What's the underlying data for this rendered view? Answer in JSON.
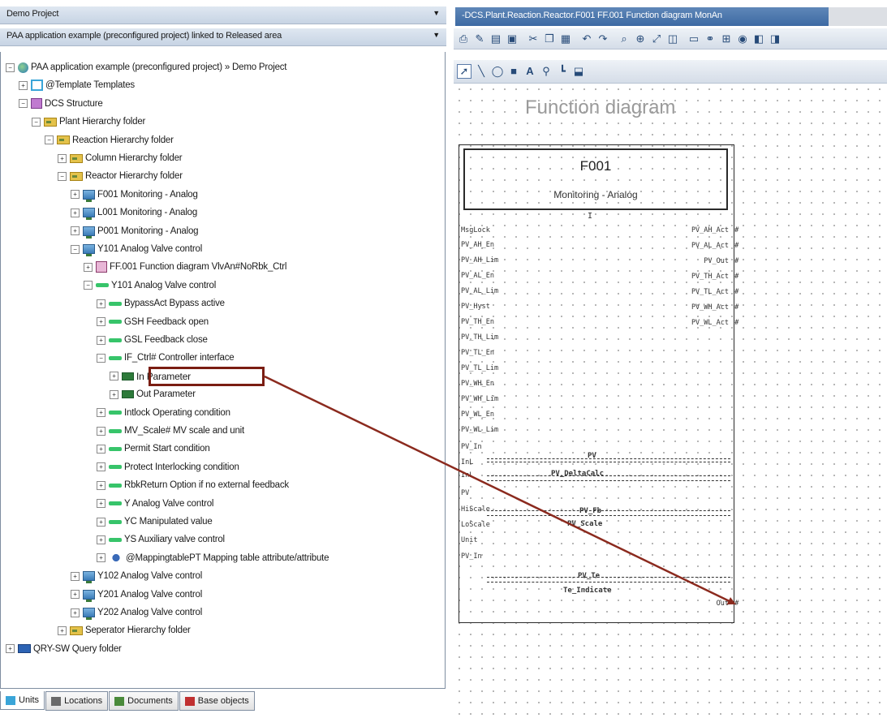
{
  "project_combo": "Demo Project",
  "app_combo": "PAA application example (preconfigured project)  linked to Released area",
  "tree": [
    {
      "label": "PAA application example (preconfigured project)   » Demo Project",
      "icon": "globe-icon",
      "indent": 0,
      "exp": "−"
    },
    {
      "label": "@Template  Templates",
      "icon": "template-icon",
      "indent": 1,
      "exp": "+"
    },
    {
      "label": "DCS  Structure",
      "icon": "structure-icon",
      "indent": 1,
      "exp": "−"
    },
    {
      "label": "Plant  Hierarchy folder",
      "icon": "folder-icon",
      "indent": 2,
      "exp": "−"
    },
    {
      "label": "Reaction  Hierarchy folder",
      "icon": "folder-icon",
      "indent": 3,
      "exp": "−"
    },
    {
      "label": "Column  Hierarchy folder",
      "icon": "folder-icon",
      "indent": 4,
      "exp": "+"
    },
    {
      "label": "Reactor  Hierarchy folder",
      "icon": "folder-icon",
      "indent": 4,
      "exp": "−"
    },
    {
      "label": "F001  Monitoring - Analog",
      "icon": "device-icon",
      "indent": 5,
      "exp": "+"
    },
    {
      "label": "L001  Monitoring - Analog",
      "icon": "device-icon",
      "indent": 5,
      "exp": "+"
    },
    {
      "label": "P001  Monitoring - Analog",
      "icon": "device-icon",
      "indent": 5,
      "exp": "+"
    },
    {
      "label": "Y101  Analog Valve control",
      "icon": "device-icon",
      "indent": 5,
      "exp": "−"
    },
    {
      "label": "FF.001  Function diagram VlvAn#NoRbk_Ctrl",
      "icon": "function-diagram-icon",
      "indent": 6,
      "exp": "+"
    },
    {
      "label": "Y101  Analog Valve control",
      "icon": "interface-icon",
      "indent": 6,
      "exp": "−"
    },
    {
      "label": "BypassAct  Bypass active",
      "icon": "interface-icon",
      "indent": 7,
      "exp": "+"
    },
    {
      "label": "GSH  Feedback open",
      "icon": "interface-icon",
      "indent": 7,
      "exp": "+"
    },
    {
      "label": "GSL  Feedback close",
      "icon": "interface-icon",
      "indent": 7,
      "exp": "+"
    },
    {
      "label": "IF_Ctrl#  Controller interface",
      "icon": "interface-icon",
      "indent": 7,
      "exp": "−"
    },
    {
      "label": "In  Parameter",
      "icon": "parameter-icon",
      "indent": 8,
      "exp": "+"
    },
    {
      "label": "Out  Parameter",
      "icon": "parameter-icon",
      "indent": 8,
      "exp": "+"
    },
    {
      "label": "Intlock  Operating condition",
      "icon": "interface-icon",
      "indent": 7,
      "exp": "+"
    },
    {
      "label": "MV_Scale#  MV scale and unit",
      "icon": "interface-icon",
      "indent": 7,
      "exp": "+"
    },
    {
      "label": "Permit  Start condition",
      "icon": "interface-icon",
      "indent": 7,
      "exp": "+"
    },
    {
      "label": "Protect  Interlocking condition",
      "icon": "interface-icon",
      "indent": 7,
      "exp": "+"
    },
    {
      "label": "RbkReturn  Option if no external feedback",
      "icon": "interface-icon",
      "indent": 7,
      "exp": "+"
    },
    {
      "label": "Y  Analog Valve control",
      "icon": "interface-icon",
      "indent": 7,
      "exp": "+"
    },
    {
      "label": "YC  Manipulated value",
      "icon": "interface-icon",
      "indent": 7,
      "exp": "+"
    },
    {
      "label": "YS  Auxiliary valve control",
      "icon": "interface-icon",
      "indent": 7,
      "exp": "+"
    },
    {
      "label": "@MappingtablePT  Mapping table attribute/attribute",
      "icon": "mapping-icon",
      "indent": 7,
      "exp": "+"
    },
    {
      "label": "Y102  Analog Valve control",
      "icon": "device-icon",
      "indent": 5,
      "exp": "+"
    },
    {
      "label": "Y201  Analog Valve control",
      "icon": "device-icon",
      "indent": 5,
      "exp": "+"
    },
    {
      "label": "Y202  Analog Valve control",
      "icon": "device-icon",
      "indent": 5,
      "exp": "+"
    },
    {
      "label": "Seperator  Hierarchy folder",
      "icon": "folder-icon",
      "indent": 4,
      "exp": "+"
    },
    {
      "label": "QRY-SW  Query folder",
      "icon": "query-folder-icon",
      "indent": 0,
      "exp": "+"
    }
  ],
  "bottom_tabs": [
    {
      "label": "Units",
      "icon": "units-icon"
    },
    {
      "label": "Locations",
      "icon": "locations-icon"
    },
    {
      "label": "Documents",
      "icon": "documents-icon"
    },
    {
      "label": "Base objects",
      "icon": "base-objects-icon"
    }
  ],
  "doc_tab": "-DCS.Plant.Reaction.Reactor.F001  FF.001  Function diagram MonAn",
  "canvas_title": "Function diagram",
  "block": {
    "name": "F001",
    "type": "Monitoring - Analog",
    "marker": "I",
    "left_pins": [
      "MsgLock",
      "PV_AH_En",
      "PV_AH_Lim",
      "PV_AL_En",
      "PV_AL_Lim",
      "PV_Hyst",
      "PV_TH_En",
      "PV_TH_Lim",
      "PV_TL_En",
      "PV_TL_Lim",
      "PV_WH_En",
      "PV_WH_Lim",
      "PV_WL_En",
      "PV_WL_Lim",
      "PV_In",
      "InL",
      "InL",
      "PV",
      "HiScale",
      "LoScale",
      "Unit",
      "PV_In"
    ],
    "right_pins": [
      "PV_AH_Act",
      "PV_AL_Act",
      "PV_Out",
      "PV_TH_Act",
      "PV_TL_Act",
      "PV_WH_Act",
      "PV_WL_Act"
    ],
    "mid_labels": [
      "PV",
      "PV_DeltaCalc",
      "PV_Fb",
      "PV_Scale",
      "PV_Te",
      "Te_Indicate"
    ],
    "out_pin": "Out"
  }
}
